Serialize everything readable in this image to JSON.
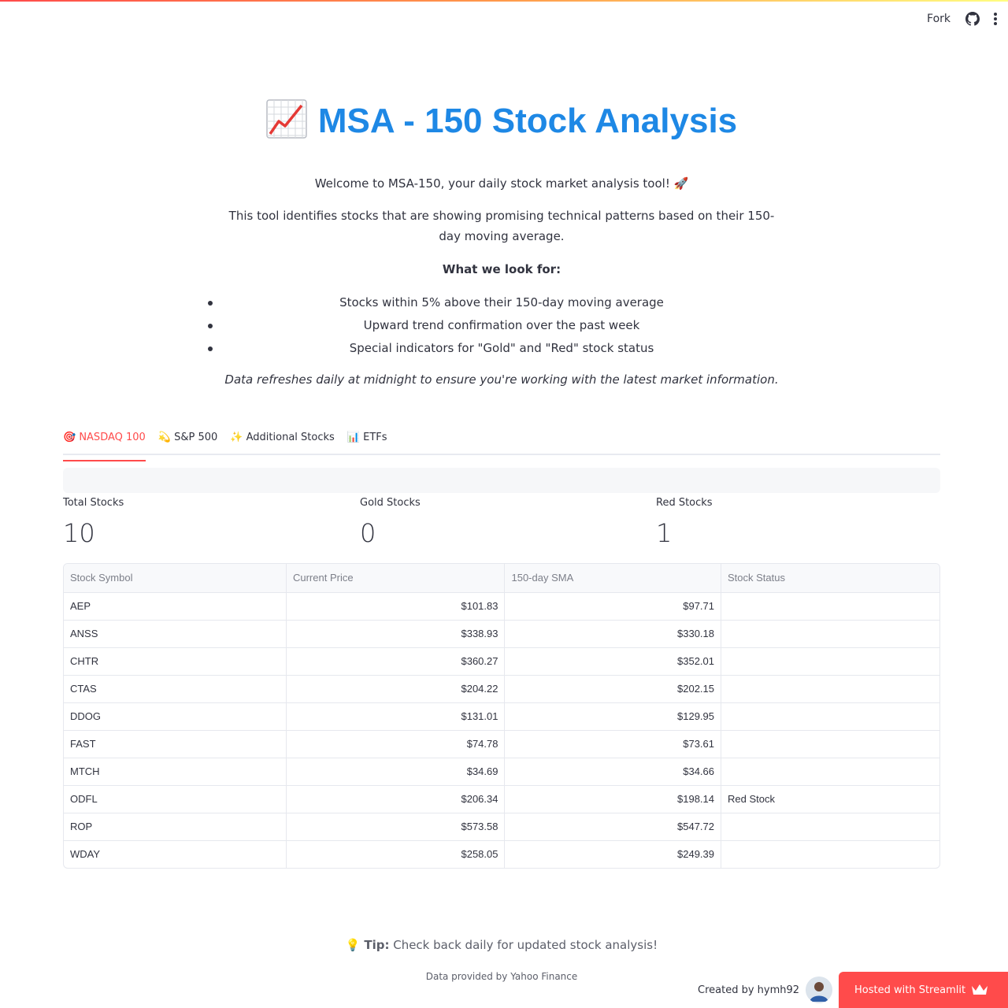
{
  "header": {
    "fork_label": "Fork",
    "icons": [
      "github-icon",
      "kebab-menu-icon"
    ],
    "accent_gradient": [
      "#ff4b4b",
      "#ff9a4b",
      "#fffd80"
    ]
  },
  "page": {
    "title": "MSA - 150 Stock Analysis",
    "title_icon": "chart-increasing-icon",
    "title_color": "#1e88e5",
    "welcome": "Welcome to MSA-150, your daily stock market analysis tool! 🚀",
    "description": "This tool identifies stocks that are showing promising technical patterns based on their 150-day moving average.",
    "look_for_heading": "What we look for:",
    "criteria": [
      "Stocks within 5% above their 150-day moving average",
      "Upward trend confirmation over the past week",
      "Special indicators for \"Gold\" and \"Red\" stock status"
    ],
    "refresh_note": "Data refreshes daily at midnight to ensure you're working with the latest market information."
  },
  "tabs": [
    {
      "label": "🎯 NASDAQ 100",
      "active": true
    },
    {
      "label": "💫 S&P 500",
      "active": false
    },
    {
      "label": "✨ Additional Stocks",
      "active": false
    },
    {
      "label": "📊 ETFs",
      "active": false
    }
  ],
  "metrics": {
    "total": {
      "label": "Total Stocks",
      "value": "10"
    },
    "gold": {
      "label": "Gold Stocks",
      "value": "0"
    },
    "red": {
      "label": "Red Stocks",
      "value": "1"
    }
  },
  "table": {
    "columns": [
      "Stock Symbol",
      "Current Price",
      "150-day SMA",
      "Stock Status"
    ],
    "rows": [
      [
        "AEP",
        "$101.83",
        "$97.71",
        ""
      ],
      [
        "ANSS",
        "$338.93",
        "$330.18",
        ""
      ],
      [
        "CHTR",
        "$360.27",
        "$352.01",
        ""
      ],
      [
        "CTAS",
        "$204.22",
        "$202.15",
        ""
      ],
      [
        "DDOG",
        "$131.01",
        "$129.95",
        ""
      ],
      [
        "FAST",
        "$74.78",
        "$73.61",
        ""
      ],
      [
        "MTCH",
        "$34.69",
        "$34.66",
        ""
      ],
      [
        "ODFL",
        "$206.34",
        "$198.14",
        "Red Stock"
      ],
      [
        "ROP",
        "$573.58",
        "$547.72",
        ""
      ],
      [
        "WDAY",
        "$258.05",
        "$249.39",
        ""
      ]
    ]
  },
  "footer": {
    "tip_icon": "💡",
    "tip_label": "Tip:",
    "tip_text": " Check back daily for updated stock analysis!",
    "source": "Data provided by Yahoo Finance",
    "created_by": "Created by hymh92",
    "hosted_label": "Hosted with Streamlit",
    "accent": "#ff4b4b"
  }
}
